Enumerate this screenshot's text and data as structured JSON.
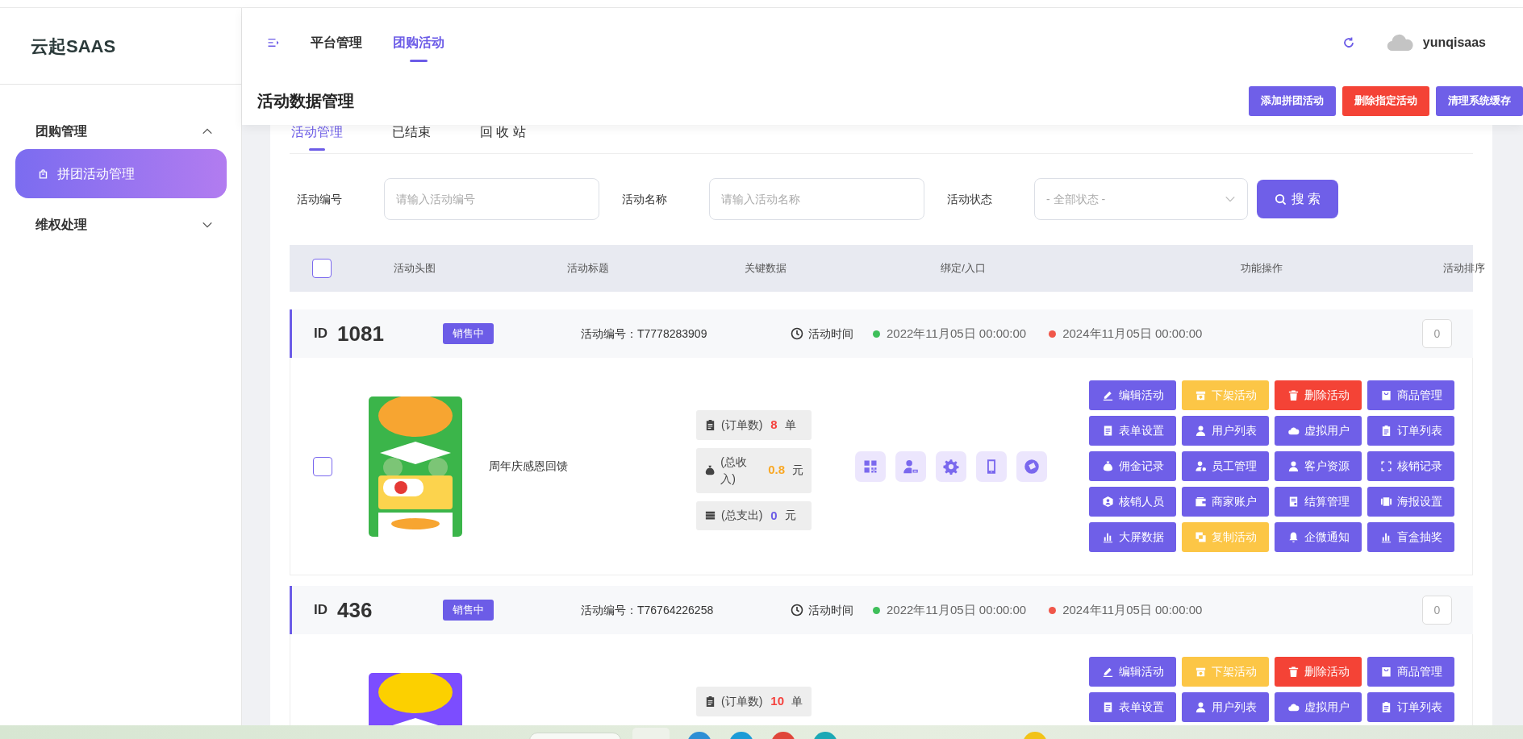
{
  "sidebar": {
    "logo": "云起SAAS",
    "groups": [
      {
        "label": "团购管理",
        "expanded": true,
        "children": [
          {
            "label": "拼团活动管理",
            "selected": true
          }
        ]
      },
      {
        "label": "维权处理",
        "expanded": false
      }
    ]
  },
  "header": {
    "nav": [
      {
        "label": "平台管理",
        "selected": false
      },
      {
        "label": "团购活动",
        "selected": true
      }
    ],
    "user": "yunqisaas"
  },
  "page_title": "活动数据管理",
  "header_buttons": [
    {
      "label": "添加拼团活动",
      "kind": "primary"
    },
    {
      "label": "删除指定活动",
      "kind": "danger"
    },
    {
      "label": "清理系统缓存",
      "kind": "primary"
    }
  ],
  "tabs": [
    {
      "label": "活动管理",
      "selected": true
    },
    {
      "label": "已结束",
      "selected": false
    },
    {
      "label": "回 收 站",
      "selected": false
    }
  ],
  "filters": [
    {
      "label": "活动编号",
      "kind": "text",
      "placeholder": "请输入活动编号"
    },
    {
      "label": "活动名称",
      "kind": "text",
      "placeholder": "请输入活动名称"
    },
    {
      "label": "活动状态",
      "kind": "select",
      "value": "- 全部状态 -"
    }
  ],
  "search_button": "搜 索",
  "table": {
    "header_checked": false,
    "columns": [
      "活动头图",
      "活动标题",
      "关键数据",
      "绑定/入口",
      "功能操作",
      "活动排序"
    ],
    "rows": [
      {
        "checked": false,
        "id_label": "ID",
        "id": "1081",
        "status": "销售中",
        "code": "活动编号：T7778283909",
        "time_label": "活动时间",
        "start": "2022年11月05日 00:00:00",
        "end": "2024年11月05日 00:00:00",
        "sort": "0",
        "image": {
          "kind": "picture"
        },
        "title": "周年庆感恩回馈",
        "stats": [
          {
            "label": "(订单数)",
            "value": "8",
            "unit": "单",
            "color": "#f5413d"
          },
          {
            "label": "(总收入)",
            "value": "0.8",
            "unit": "元",
            "color": "#f9a825"
          },
          {
            "label": "(总支出)",
            "value": "0",
            "unit": "元",
            "color": "#6c5ce7"
          }
        ],
        "bindings_visible": true,
        "actions": [
          {
            "label": "编辑活动",
            "kind": "primary"
          },
          {
            "label": "下架活动",
            "kind": "warning"
          },
          {
            "label": "删除活动",
            "kind": "danger"
          },
          {
            "label": "商品管理",
            "kind": "primary"
          },
          {
            "label": "表单设置",
            "kind": "primary"
          },
          {
            "label": "用户列表",
            "kind": "primary"
          },
          {
            "label": "虚拟用户",
            "kind": "primary"
          },
          {
            "label": "订单列表",
            "kind": "primary"
          },
          {
            "label": "佣金记录",
            "kind": "primary"
          },
          {
            "label": "员工管理",
            "kind": "primary"
          },
          {
            "label": "客户资源",
            "kind": "primary"
          },
          {
            "label": "核销记录",
            "kind": "primary"
          },
          {
            "label": "核销人员",
            "kind": "primary"
          },
          {
            "label": "商家账户",
            "kind": "primary"
          },
          {
            "label": "结算管理",
            "kind": "primary"
          },
          {
            "label": "海报设置",
            "kind": "primary"
          },
          {
            "label": "大屏数据",
            "kind": "primary"
          },
          {
            "label": "复制活动",
            "kind": "warning"
          },
          {
            "label": "企微通知",
            "kind": "primary"
          },
          {
            "label": "盲盒抽奖",
            "kind": "primary"
          }
        ]
      },
      {
        "id_label": "ID",
        "id": "436",
        "status": "销售中",
        "code": "活动编号：T76764226258",
        "time_label": "活动时间",
        "start": "2022年11月05日 00:00:00",
        "end": "2024年11月05日 00:00:00",
        "sort": "0",
        "image": {
          "kind": "picture"
        },
        "stats": [
          {
            "label": "(订单数)",
            "value": "10",
            "unit": "单",
            "color": "#f5413d"
          }
        ],
        "actions": [
          {
            "label": "编辑活动",
            "kind": "primary"
          },
          {
            "label": "下架活动",
            "kind": "warning"
          },
          {
            "label": "删除活动",
            "kind": "danger"
          },
          {
            "label": "商品管理",
            "kind": "primary"
          },
          {
            "label": "表单设置",
            "kind": "primary"
          },
          {
            "label": "用户列表",
            "kind": "primary"
          },
          {
            "label": "虚拟用户",
            "kind": "primary"
          },
          {
            "label": "订单列表",
            "kind": "primary"
          }
        ]
      }
    ]
  }
}
